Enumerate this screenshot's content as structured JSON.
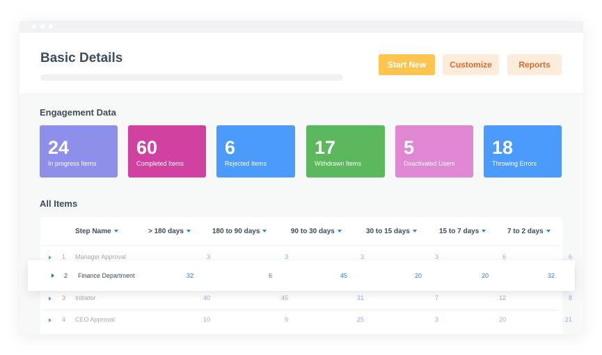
{
  "header": {
    "title": "Basic Details",
    "progress_percent": 0,
    "buttons": [
      {
        "label": "Start New",
        "bg": "#ffc44d",
        "color": "#ffffff"
      },
      {
        "label": "Customize",
        "bg": "#fdecd9",
        "color": "#e2692a"
      },
      {
        "label": "Reports",
        "bg": "#fdecd9",
        "color": "#e2692a"
      }
    ]
  },
  "engagement": {
    "title": "Engagement Data",
    "cards": [
      {
        "value": "24",
        "label": "In progress Items",
        "color": "#8d8fea"
      },
      {
        "value": "60",
        "label": "Completed Items",
        "color": "#d1419f"
      },
      {
        "value": "6",
        "label": "Rejected Items",
        "color": "#4a9bfb"
      },
      {
        "value": "17",
        "label": "Withdrawn Items",
        "color": "#5cb85c"
      },
      {
        "value": "5",
        "label": "Deactivated Users",
        "color": "#e087d3"
      },
      {
        "value": "18",
        "label": "Throwing Errors",
        "color": "#4a9bfb"
      }
    ]
  },
  "table": {
    "title": "All Items",
    "columns": [
      "Step Name",
      "> 180 days",
      "180 to 90 days",
      "90 to 30 days",
      "30 to 15 days",
      "15 to 7 days",
      "7 to 2 days"
    ],
    "rows": [
      {
        "index": "1",
        "name": "Manager Approval",
        "values": [
          "3",
          "3",
          "3",
          "3",
          "6",
          "6"
        ]
      },
      {
        "index": "2",
        "name": "Finance Department",
        "values": [
          "32",
          "6",
          "45",
          "20",
          "20",
          "32"
        ],
        "highlighted": true
      },
      {
        "index": "3",
        "name": "Initiator",
        "values": [
          "40",
          "45",
          "31",
          "7",
          "12",
          "8"
        ]
      },
      {
        "index": "4",
        "name": "CEO Approval",
        "values": [
          "10",
          "9",
          "25",
          "3",
          "20",
          "21"
        ]
      }
    ]
  }
}
